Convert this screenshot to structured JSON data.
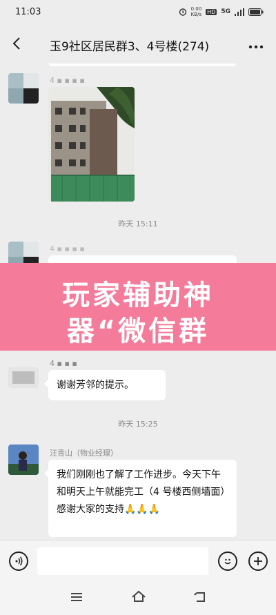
{
  "status_bar": {
    "time": "11:03",
    "speed": "0.00\nKB/s",
    "hd": "HD",
    "network": "5G"
  },
  "header": {
    "back_icon": "chevron-left-icon",
    "title": "玉9社区居民群3、4号楼(274)",
    "more_icon": "more-dots-icon"
  },
  "messages": {
    "m1": {
      "sender": "4 ▪ ▪ ▪ ▪",
      "type": "image"
    },
    "ts1": "昨天 15:11",
    "m2": {
      "sender": "4 ▪ ▪ ▪ ▪"
    },
    "m3": {
      "sender": "4 ▪ ▪ ▪",
      "text": "谢谢芳邻的提示。"
    },
    "ts2": "昨天 15:25",
    "m4": {
      "sender": "汪青山（物业经理）",
      "text": "我们刚刚也了解了工作进步。今天下午和明天上午就能完工（4 号楼西侧墙面）感谢大家的支持🙏🙏🙏"
    }
  },
  "overlay": {
    "line1": "玩家辅助神",
    "line2": "器“微信群"
  },
  "input_bar": {
    "voice_icon": "voice-icon",
    "emoji_icon": "emoji-icon",
    "plus_icon": "plus-icon",
    "placeholder": ""
  },
  "nav_bar": {
    "menu": "menu-icon",
    "home": "home-icon",
    "back": "back-icon"
  },
  "colors": {
    "background": "#ededed",
    "overlay": "#f47b9a",
    "bubble": "#ffffff"
  }
}
